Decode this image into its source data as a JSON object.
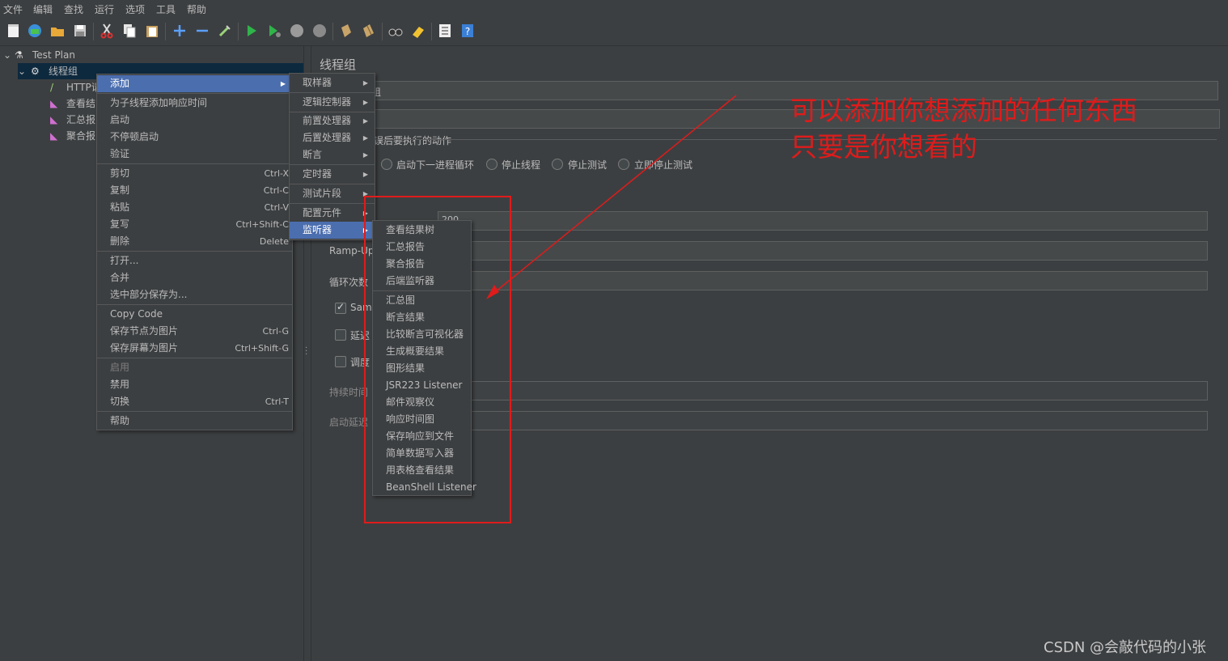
{
  "menubar": [
    "文件",
    "编辑",
    "查找",
    "运行",
    "选项",
    "工具",
    "帮助"
  ],
  "tree": {
    "test_plan": "Test Plan",
    "thread_group": "线程组",
    "children": [
      "HTTP请",
      "查看结",
      "汇总报",
      "聚合报"
    ]
  },
  "panel": {
    "title": "线程组",
    "name_value": "程组",
    "error_action_label": "误后要执行的动作",
    "radios": [
      "启动下一进程循环",
      "停止线程",
      "停止测试",
      "立即停止测试"
    ],
    "threads_value": "200",
    "rampup_label": "Ramp-Up",
    "loop_label": "循环次数",
    "same_user_label": "Same",
    "delay_label": "延迟",
    "scheduler_label": "调度",
    "duration_label": "持续时间",
    "startup_delay_label": "启动延迟"
  },
  "context_menu": {
    "add": "添加",
    "add_response_time": "为子线程添加响应时间",
    "start": "启动",
    "start_no_pause": "不停顿启动",
    "validate": "验证",
    "cut": "剪切",
    "cut_sc": "Ctrl-X",
    "copy": "复制",
    "copy_sc": "Ctrl-C",
    "paste": "粘贴",
    "paste_sc": "Ctrl-V",
    "duplicate": "复写",
    "duplicate_sc": "Ctrl+Shift-C",
    "delete": "删除",
    "delete_sc": "Delete",
    "open": "打开...",
    "merge": "合并",
    "save_selection": "选中部分保存为...",
    "copy_code": "Copy Code",
    "save_node_image": "保存节点为图片",
    "save_node_image_sc": "Ctrl-G",
    "save_screen_image": "保存屏幕为图片",
    "save_screen_image_sc": "Ctrl+Shift-G",
    "enable": "启用",
    "disable": "禁用",
    "toggle": "切换",
    "toggle_sc": "Ctrl-T",
    "help": "帮助"
  },
  "add_submenu": [
    "取样器",
    "逻辑控制器",
    "前置处理器",
    "后置处理器",
    "断言",
    "定时器",
    "测试片段",
    "配置元件",
    "监听器"
  ],
  "listener_submenu": [
    "查看结果树",
    "汇总报告",
    "聚合报告",
    "后端监听器",
    "汇总图",
    "断言结果",
    "比较断言可视化器",
    "生成概要结果",
    "图形结果",
    "JSR223 Listener",
    "邮件观察仪",
    "响应时间图",
    "保存响应到文件",
    "简单数据写入器",
    "用表格查看结果",
    "BeanShell Listener"
  ],
  "annotation": {
    "line1": "可以添加你想添加的任何东西",
    "line2": "只要是你想看的",
    "color": "#e01b1b"
  },
  "watermark": "CSDN @会敲代码的小张"
}
